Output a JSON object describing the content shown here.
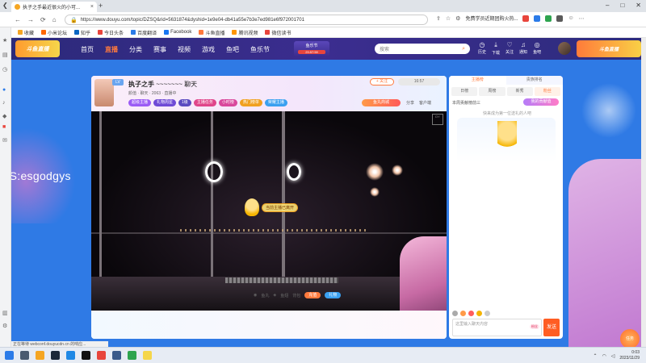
{
  "browser": {
    "tab_title": "执子之手最近很火的小可...",
    "url": "https://www.douyu.com/topic/DZSQ&rid=5631874&dyshid=1e9e04-db41a55e7b3e7ed981e6f972001701",
    "extension_text": "免费学员近期团购火热...",
    "bookmarks": [
      "收藏",
      "小米论坛",
      "知乎",
      "今日头条",
      "百度翻译",
      "Facebook",
      "斗鱼直播",
      "腾讯视频",
      "微信读书"
    ]
  },
  "site": {
    "logo": "斗鱼直播",
    "nav": [
      "首页",
      "直播",
      "分类",
      "赛事",
      "视频",
      "游戏",
      "鱼吧",
      "鱼乐节"
    ],
    "promo_top": "鱼乐节",
    "promo_bottom": "23:57:59",
    "search_placeholder": "搜索",
    "user_icons": [
      "历史",
      "下载",
      "关注",
      "通知",
      "鱼吧"
    ],
    "right_banner": "斗鱼直播"
  },
  "watermark": "YS:esgodgys",
  "room": {
    "level": "LV",
    "title": "执子之手",
    "title_suffix": "~~~~~~~ 聊天",
    "meta": "颜值 · 聊天 · 2063 · 直播中",
    "follow": "+ 关注",
    "count": "16:57",
    "badges": [
      "超级主播",
      "礼物周星",
      "1级",
      "主播任务",
      "小时榜",
      "热门榜单",
      "荣耀主播"
    ],
    "badge_colors": [
      "#9b5cf5",
      "#6f4ad6",
      "#5b4ac0",
      "#e0458a",
      "#d9489c",
      "#f0a020",
      "#3aa0f0"
    ],
    "shop": "鱼丸商城",
    "share": [
      "分享",
      "客户端"
    ]
  },
  "video": {
    "mascot_tip": "当前主播已离开"
  },
  "giftbar": {
    "info": [
      "鱼丸",
      "鱼翅",
      "背包"
    ],
    "btn1": "充值",
    "btn2": "礼物"
  },
  "chat": {
    "tabs1": [
      "主播榜",
      "贵族排名"
    ],
    "tabs2": [
      "日榜",
      "周榜",
      "新秀",
      "粉丝"
    ],
    "rank_text": "本周贡献榜前三",
    "rank_button": "我的贡献值",
    "empty": "快来成为第一位送礼的人吧",
    "input_placeholder": "这里输入聊天内容",
    "fan_badge": "粉丝",
    "send": "发送"
  },
  "status_text": "正在等待 webconf.douyucdn.cn 的响应...",
  "float_icon": "任务",
  "taskbar": {
    "time": "0:03",
    "date": "2023/11/29"
  }
}
